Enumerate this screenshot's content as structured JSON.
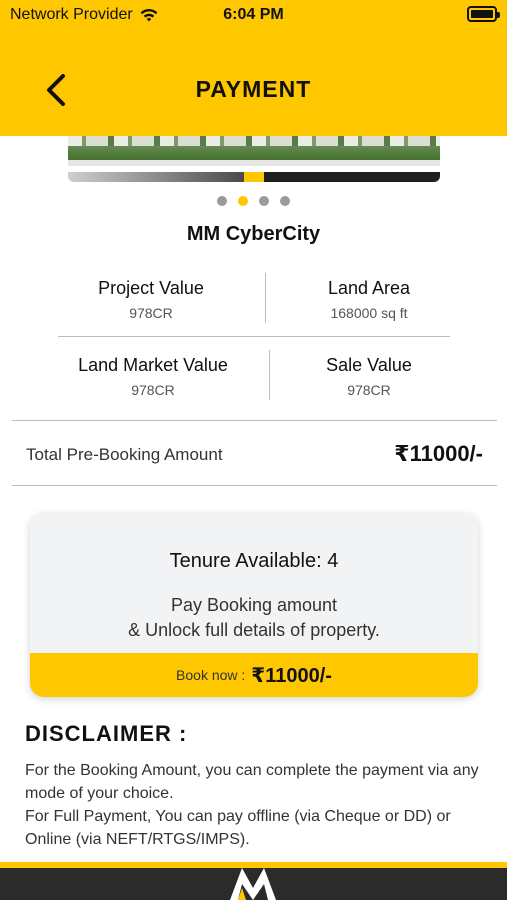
{
  "status_bar": {
    "carrier": "Network Provider",
    "time": "6:04 PM"
  },
  "header": {
    "title": "PAYMENT"
  },
  "carousel": {
    "slide_count": 4,
    "active_index": 1
  },
  "project": {
    "name": "MM CyberCity"
  },
  "stats": {
    "project_value": {
      "label": "Project Value",
      "value": "978CR"
    },
    "land_area": {
      "label": "Land Area",
      "value": "168000 sq ft"
    },
    "land_market_value": {
      "label": "Land Market Value",
      "value": "978CR"
    },
    "sale_value": {
      "label": "Sale Value",
      "value": "978CR"
    }
  },
  "total": {
    "label": "Total Pre-Booking Amount",
    "amount": "₹11000/-"
  },
  "booking_card": {
    "tenure": "Tenure Available: 4",
    "line1": "Pay Booking amount",
    "line2": "& Unlock full details of property.",
    "book_now_label": "Book now :",
    "book_now_amount": "₹11000/-"
  },
  "disclaimer": {
    "title": "DISCLAIMER :",
    "text": "For the Booking Amount, you can complete the payment via any mode of your choice.\nFor Full Payment, You can pay offline (via Cheque or DD) or Online (via NEFT/RTGS/IMPS)."
  },
  "colors": {
    "brand_yellow": "#FFC700",
    "footer_dark": "#2b2b2b"
  }
}
